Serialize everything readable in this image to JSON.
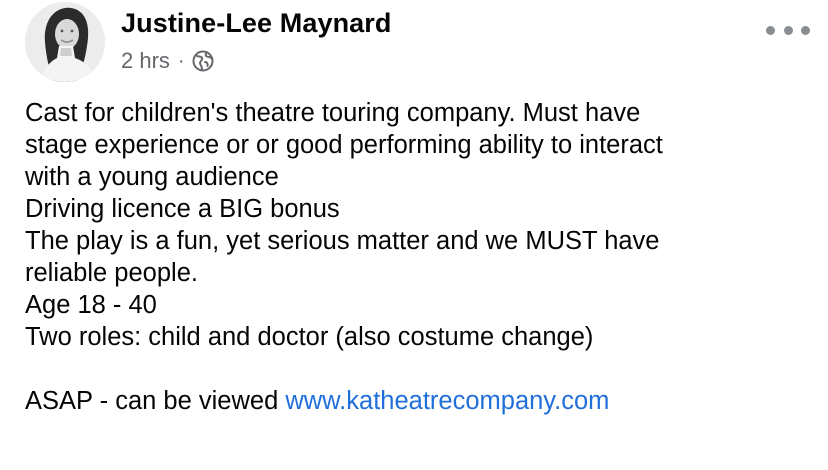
{
  "post": {
    "author": "Justine-Lee Maynard",
    "time": "2 hrs",
    "separator": "·",
    "privacy_icon": "globe-icon",
    "more_icon": "more-options-icon",
    "lines": [
      "Cast for children's theatre touring company. Must have",
      "stage experience or or good performing ability to interact",
      "with a young audience",
      "Driving licence a BIG bonus",
      "The play is a fun, yet serious matter and we MUST have",
      "reliable people.",
      "Age 18 - 40",
      "Two roles: child and doctor (also costume change)"
    ],
    "last_line_prefix": "ASAP - can be viewed ",
    "link_text": "www.katheatrecompany.com"
  },
  "colors": {
    "text": "#050505",
    "meta": "#65676b",
    "link": "#216fdb",
    "icon": "#8a8d91"
  }
}
